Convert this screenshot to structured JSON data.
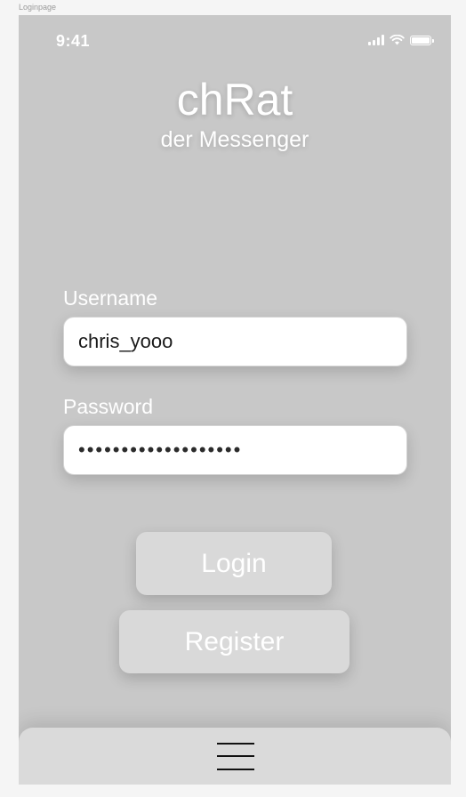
{
  "frame": {
    "label": "Loginpage"
  },
  "status_bar": {
    "time": "9:41",
    "icons": [
      "signal-icon",
      "wifi-icon",
      "battery-icon"
    ]
  },
  "brand": {
    "title": "chRat",
    "subtitle": "der Messenger"
  },
  "form": {
    "username": {
      "label": "Username",
      "value": "chris_yooo"
    },
    "password": {
      "label": "Password",
      "masked_value": "•••••••••••••••••••"
    }
  },
  "buttons": {
    "login": "Login",
    "register": "Register"
  },
  "bottom_bar": {
    "icon": "hamburger-menu-icon"
  },
  "colors": {
    "background": "#c8c8c8",
    "button": "#d9d9d9",
    "text_light": "#ffffff",
    "bottom_bar": "#dadada"
  }
}
